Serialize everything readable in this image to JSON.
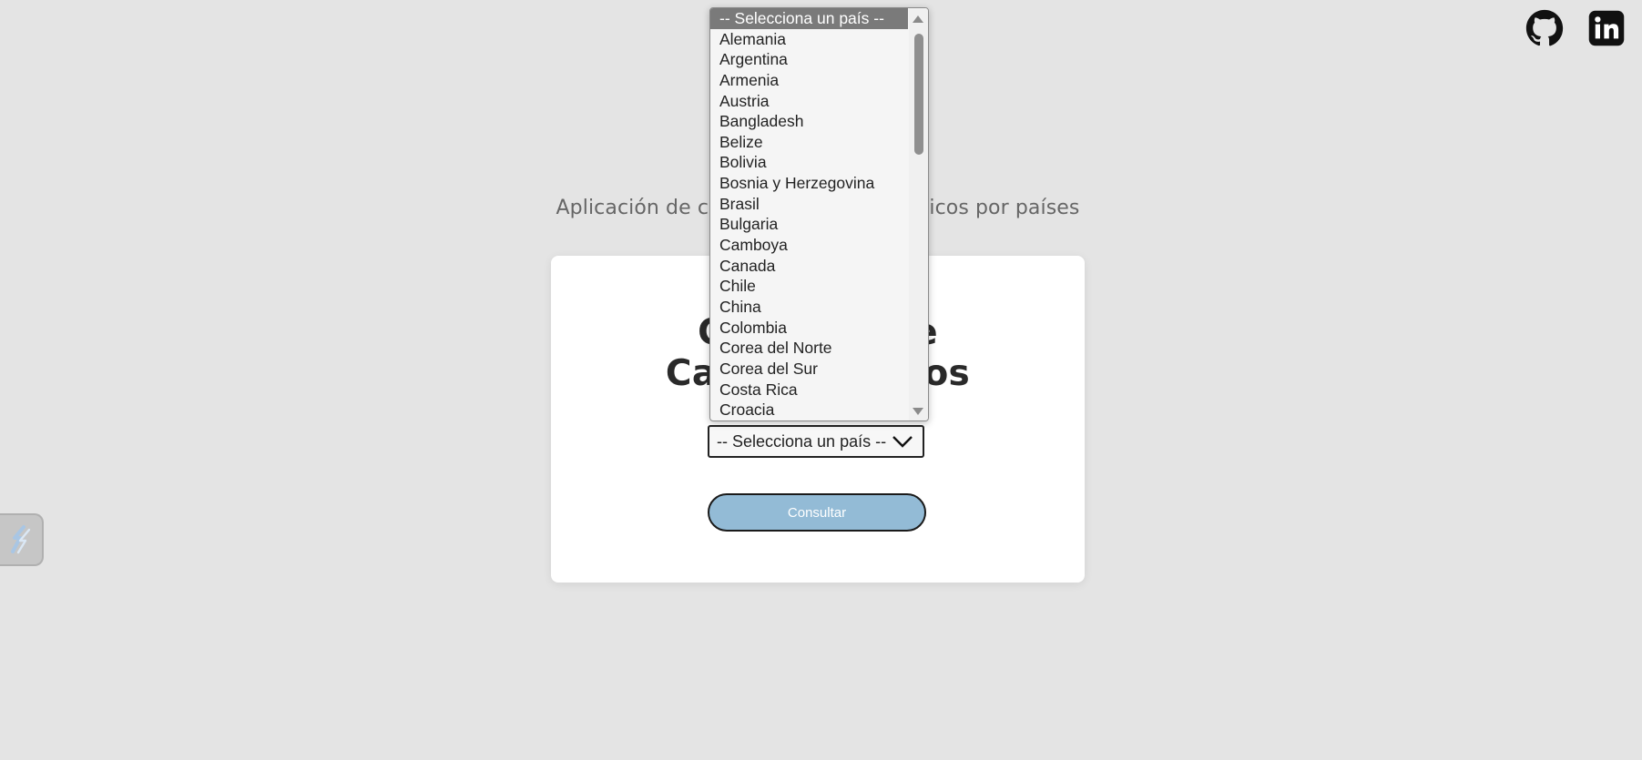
{
  "header": {
    "github_icon": "github-icon",
    "linkedin_icon": "linkedin-icon"
  },
  "subtitle": "Aplicación de consulta de característicos por países",
  "card": {
    "title": "Consulta de Característicos",
    "select": {
      "value": "-- Selecciona un país --",
      "chevron_icon": "chevron-down-icon"
    },
    "button_label": "Consultar"
  },
  "dropdown": {
    "options": [
      "-- Selecciona un país --",
      "Alemania",
      "Argentina",
      "Armenia",
      "Austria",
      "Bangladesh",
      "Belize",
      "Bolivia",
      "Bosnia y Herzegovina",
      "Brasil",
      "Bulgaria",
      "Camboya",
      "Canada",
      "Chile",
      "China",
      "Colombia",
      "Corea del Norte",
      "Corea del Sur",
      "Costa Rica",
      "Croacia"
    ],
    "selected_index": 0
  },
  "side_widget_icon": "extension-icon",
  "colors": {
    "background": "#e4e4e4",
    "button": "#93bbd6",
    "selected_option": "#7a7a7a"
  }
}
